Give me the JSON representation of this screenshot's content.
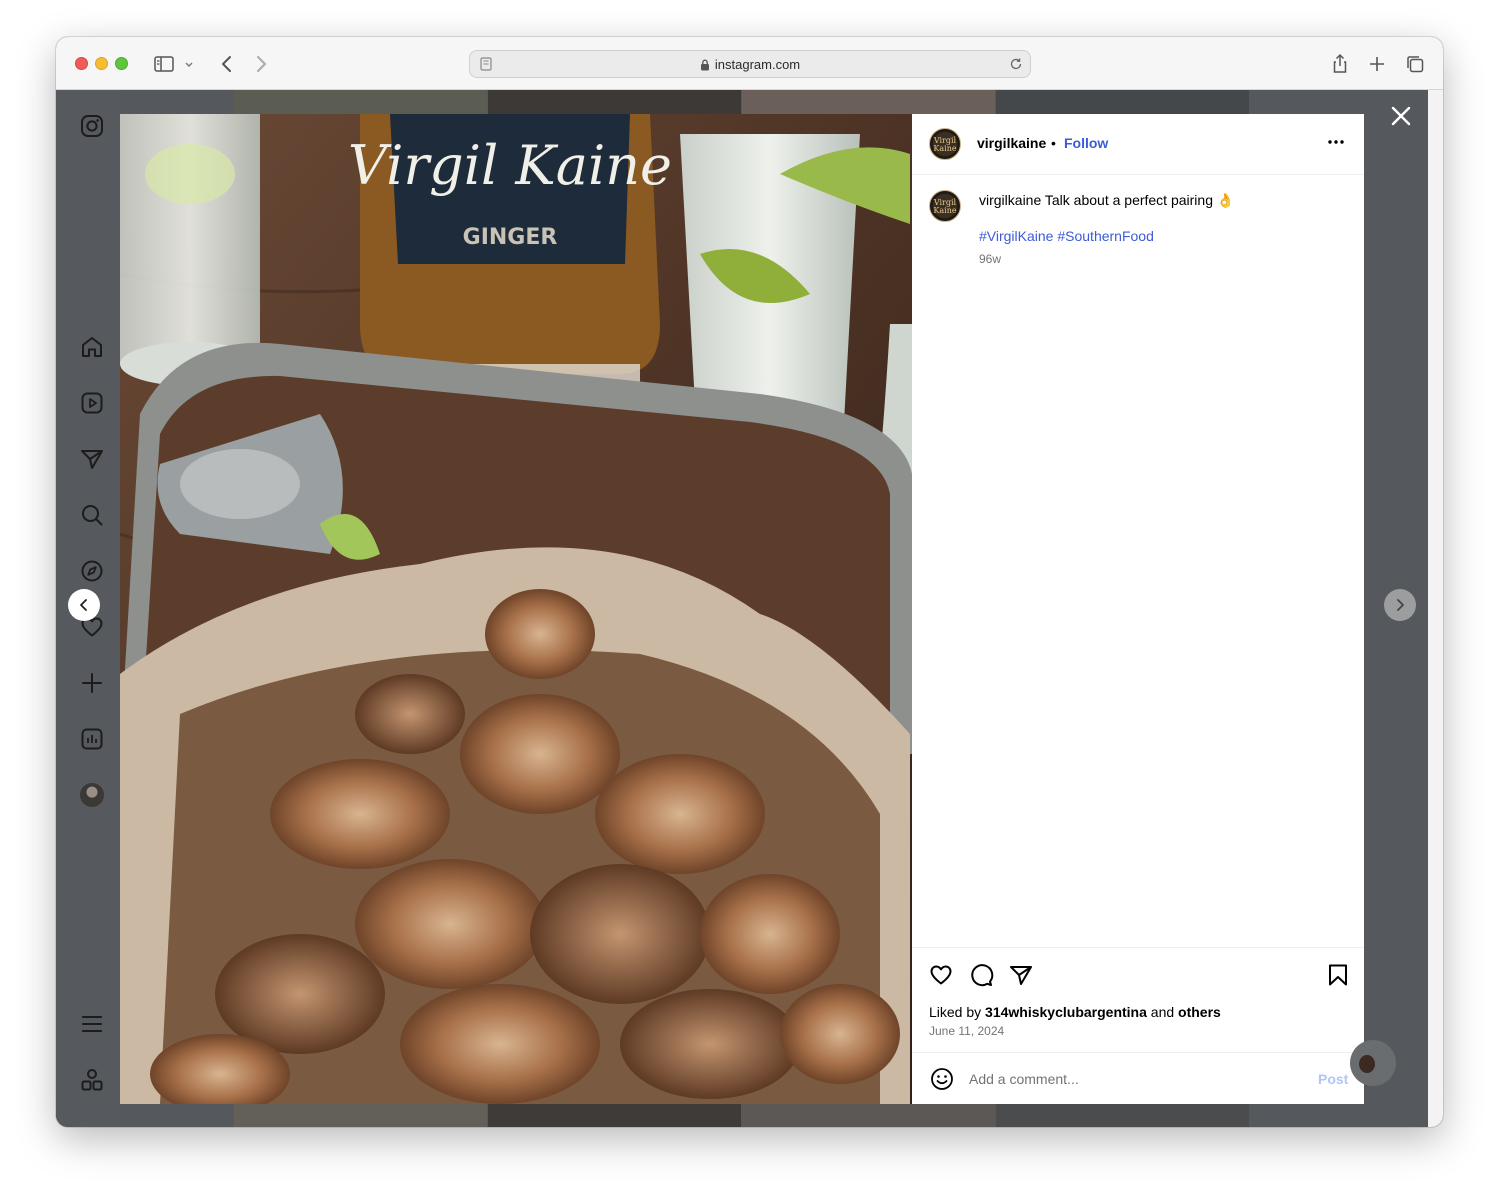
{
  "browser": {
    "url": "instagram.com"
  },
  "post": {
    "username": "virgilkaine",
    "follow_label": "Follow",
    "separator": "•",
    "avatar_text": "Virgil Kaine",
    "caption_user": "virgilkaine",
    "caption_text": "Talk about a perfect pairing 👌",
    "hashtags": [
      "#VirgilKaine",
      "#SouthernFood"
    ],
    "age": "96w",
    "liked_by_prefix": "Liked by",
    "liked_by_user": "314whiskyclubargentina",
    "liked_by_and": "and",
    "liked_by_others": "others",
    "date": "June 11, 2024",
    "comment_placeholder": "Add a comment...",
    "post_label": "Post"
  },
  "photo": {
    "bottle_text": "Virgil Kaine",
    "bottle_subtext": "GINGER"
  },
  "sidebar": {
    "items": [
      "instagram-logo",
      "home",
      "reels",
      "messages",
      "search",
      "explore",
      "notifications",
      "create",
      "dashboard",
      "profile",
      "more",
      "also-from-meta"
    ]
  },
  "colors": {
    "overlay": "#55585c",
    "link": "#3d5bd8",
    "post_disabled": "#b3c4f7"
  }
}
